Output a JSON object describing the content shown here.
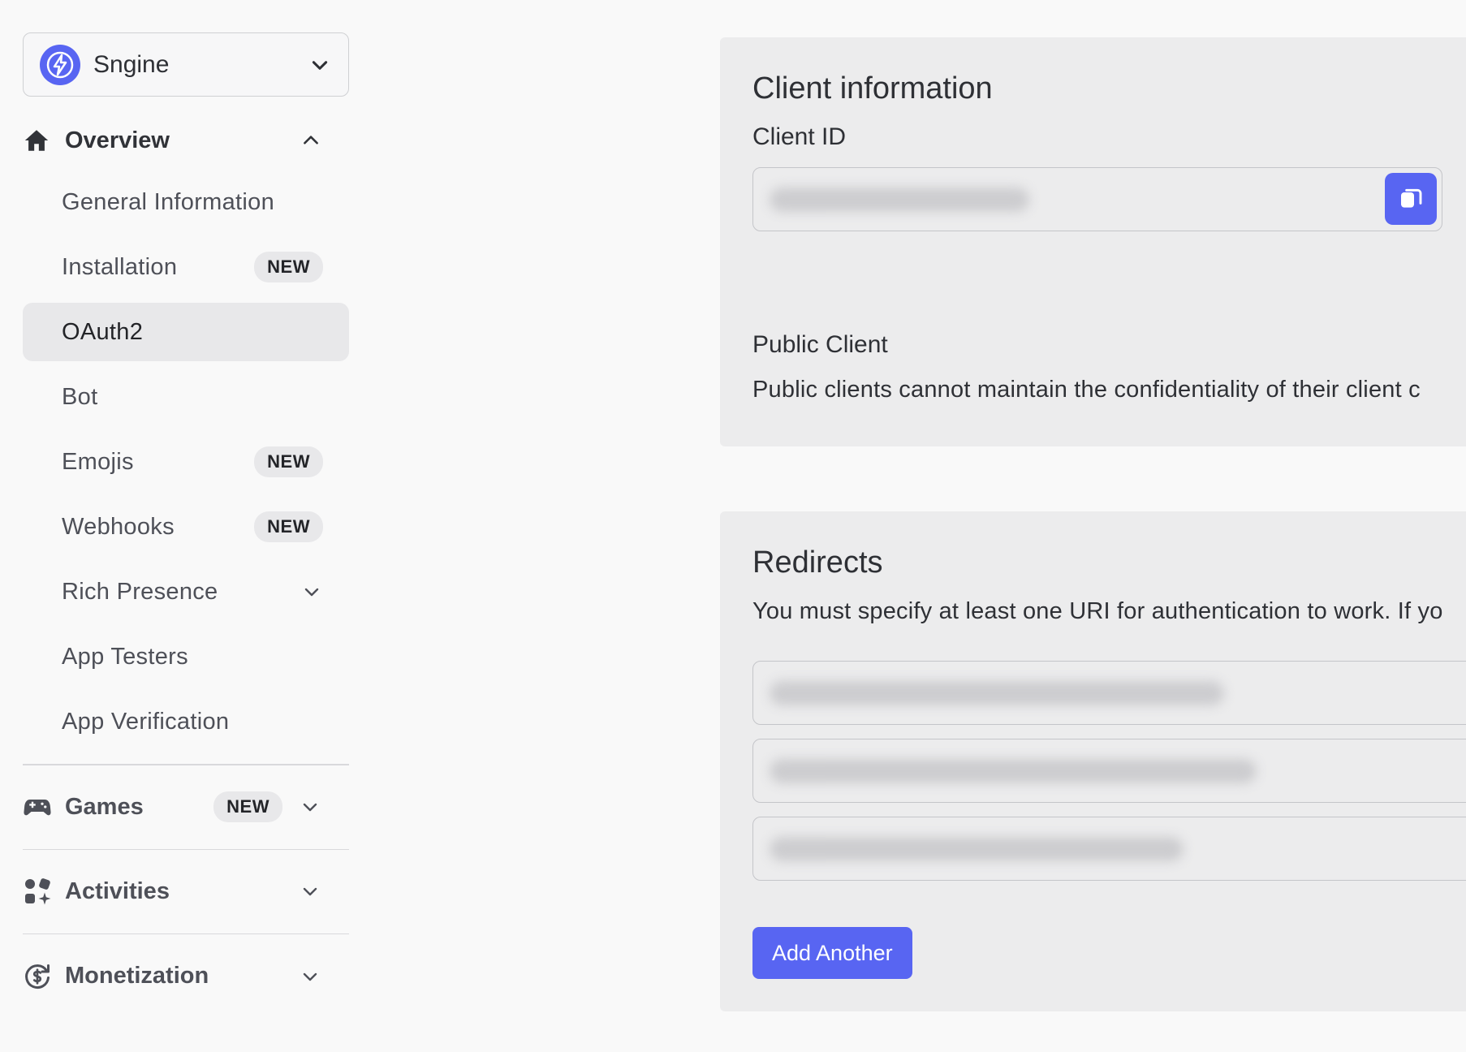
{
  "app_selector": {
    "name": "Sngine"
  },
  "sidebar": {
    "overview": {
      "label": "Overview"
    },
    "items": [
      {
        "label": "General Information",
        "badge": ""
      },
      {
        "label": "Installation",
        "badge": "NEW"
      },
      {
        "label": "OAuth2",
        "badge": ""
      },
      {
        "label": "Bot",
        "badge": ""
      },
      {
        "label": "Emojis",
        "badge": "NEW"
      },
      {
        "label": "Webhooks",
        "badge": "NEW"
      },
      {
        "label": "Rich Presence",
        "badge": ""
      },
      {
        "label": "App Testers",
        "badge": ""
      },
      {
        "label": "App Verification",
        "badge": ""
      }
    ],
    "groups": [
      {
        "label": "Games",
        "badge": "NEW"
      },
      {
        "label": "Activities",
        "badge": ""
      },
      {
        "label": "Monetization",
        "badge": ""
      }
    ],
    "active_item": "OAuth2"
  },
  "client_info": {
    "title": "Client information",
    "client_id_label": "Client ID",
    "public_client_label": "Public Client",
    "public_client_desc": "Public clients cannot maintain the confidentiality of their client c"
  },
  "redirects": {
    "title": "Redirects",
    "desc": "You must specify at least one URI for authentication to work. If yo",
    "add_button": "Add Another"
  },
  "colors": {
    "accent": "#5865f2",
    "card_bg": "#ececed",
    "page_bg": "#f9f9f9"
  }
}
